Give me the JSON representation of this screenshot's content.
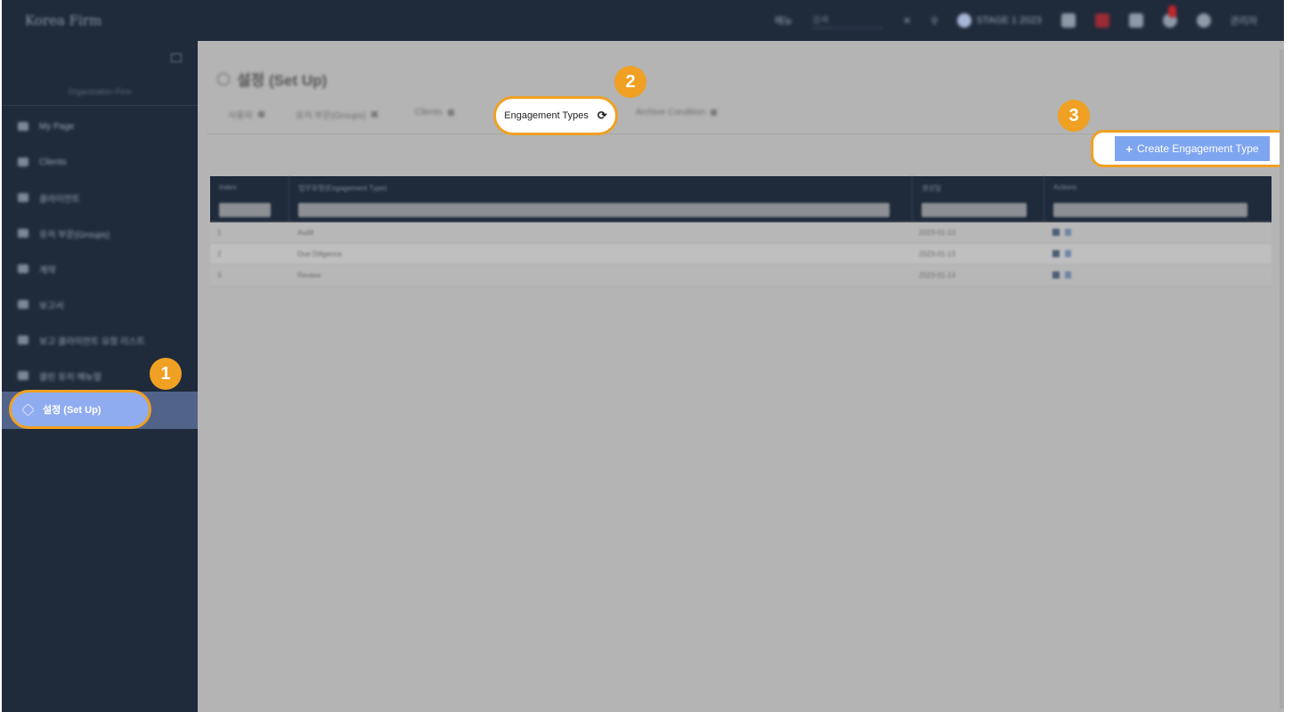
{
  "topbar": {
    "brand": "Korea Firm",
    "menu_a": "메뉴",
    "search_placeholder": "검색",
    "trial_label": "STAGE 1 2023",
    "user": "관리자"
  },
  "sidebar": {
    "org_label": "Organization Firm",
    "items": [
      {
        "label": "My Page"
      },
      {
        "label": "Clients"
      },
      {
        "label": "클라이언트"
      },
      {
        "label": "유저 부문(Groups)"
      },
      {
        "label": "계약"
      },
      {
        "label": "보고서"
      },
      {
        "label": "보고 클라이언트 요청 리스트"
      },
      {
        "label": "클린 유저 매뉴얼"
      }
    ],
    "active_label": "설정 (Set Up)"
  },
  "page": {
    "title": "설정 (Set Up)"
  },
  "tabs": [
    {
      "label": "사용자"
    },
    {
      "label": "유저 부문(Groups)"
    },
    {
      "label": "Clients"
    },
    {
      "label": "Engagement Types",
      "active": true
    },
    {
      "label": "Archive Condition"
    }
  ],
  "create_button": {
    "icon": "plus-icon",
    "label": "Create Engagement Type"
  },
  "table": {
    "columns": [
      "Index",
      "업무유형(Engagement Type)",
      "생성일",
      "Actions"
    ],
    "rows": [
      {
        "index": "1",
        "type": "Audit",
        "date": "2023-01-13"
      },
      {
        "index": "2",
        "type": "Due Diligence",
        "date": "2023-01-13"
      },
      {
        "index": "3",
        "type": "Review",
        "date": "2023-01-13"
      }
    ]
  },
  "callouts": [
    "1",
    "2",
    "3"
  ],
  "colors": {
    "sidebar": "#1f2b3b",
    "highlight": "#f0a022",
    "active_pill": "#90acf0",
    "button": "#7ea5f0"
  }
}
